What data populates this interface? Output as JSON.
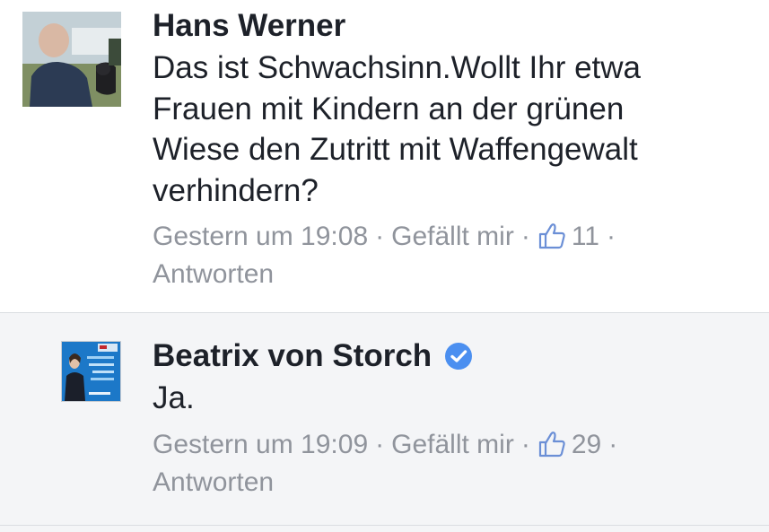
{
  "comments": [
    {
      "author": "Hans Werner",
      "message": "Das ist Schwachsinn.Wollt Ihr etwa Frauen mit Kindern an der grünen Wiese den Zutritt mit Waffengewalt verhindern?",
      "message_lines": [
        "Das ist Schwachsinn.Wollt Ihr etwa",
        "Frauen mit Kindern an der grünen",
        "Wiese den Zutritt mit Waffengewalt",
        "verhindern?"
      ],
      "timestamp": "Gestern um 19:08",
      "like_label": "Gefällt mir",
      "like_count": "11",
      "reply_label": "Antworten",
      "verified": false
    },
    {
      "author": "Beatrix von Storch",
      "message": "Ja.",
      "timestamp": "Gestern um 19:09",
      "like_label": "Gefällt mir",
      "like_count": "29",
      "reply_label": "Antworten",
      "verified": true
    }
  ],
  "separator": "·",
  "icons": {
    "like": "thumbs-up-icon",
    "verified": "verified-badge-icon"
  },
  "colors": {
    "text_primary": "#1d2129",
    "text_meta": "#90949c",
    "verified_blue": "#4b8ff0",
    "reply_background": "#f4f5f7"
  }
}
